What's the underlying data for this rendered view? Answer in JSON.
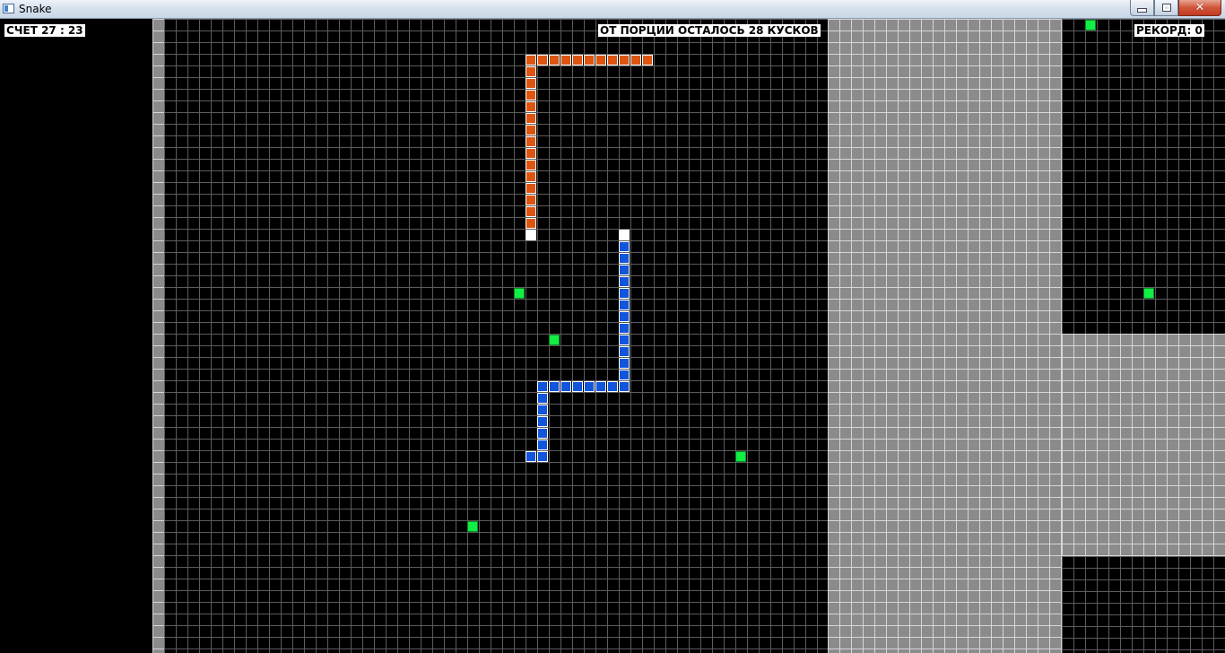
{
  "window": {
    "title": "Snake",
    "controls": {
      "minimize_icon": "minimize-icon",
      "maximize_icon": "restore-icon",
      "close_icon": "close-icon"
    }
  },
  "hud": {
    "score_text": "СЧЕТ 27 : 23",
    "portion_text": "ОТ ПОРЦИИ ОСТАЛОСЬ 28 КУСКОВ",
    "record_text": "РЕКОРД: 0"
  },
  "colors": {
    "background": "#000000",
    "grid_line_dark": "#5c5c5c",
    "wall_fill": "#8b8b8b",
    "wall_grid_line": "#d6d6d6",
    "snake_orange": "#dd5511",
    "snake_blue": "#1155dd",
    "snake_head": "#ffffff",
    "food": "#11ee44",
    "label_bg": "#ffffff",
    "label_text": "#000000"
  },
  "board": {
    "cell_size": 13,
    "origin_col": 0,
    "snakes": [
      {
        "name": "orange",
        "color_key": "snake_orange",
        "head": [
          45,
          18
        ],
        "body": [
          [
            55,
            3
          ],
          [
            54,
            3
          ],
          [
            53,
            3
          ],
          [
            52,
            3
          ],
          [
            51,
            3
          ],
          [
            50,
            3
          ],
          [
            49,
            3
          ],
          [
            48,
            3
          ],
          [
            47,
            3
          ],
          [
            46,
            3
          ],
          [
            45,
            3
          ],
          [
            45,
            4
          ],
          [
            45,
            5
          ],
          [
            45,
            6
          ],
          [
            45,
            7
          ],
          [
            45,
            8
          ],
          [
            45,
            9
          ],
          [
            45,
            10
          ],
          [
            45,
            11
          ],
          [
            45,
            12
          ],
          [
            45,
            13
          ],
          [
            45,
            14
          ],
          [
            45,
            15
          ],
          [
            45,
            16
          ],
          [
            45,
            17
          ]
        ]
      },
      {
        "name": "blue",
        "color_key": "snake_blue",
        "head": [
          53,
          18
        ],
        "body": [
          [
            53,
            19
          ],
          [
            53,
            20
          ],
          [
            53,
            21
          ],
          [
            53,
            22
          ],
          [
            53,
            23
          ],
          [
            53,
            24
          ],
          [
            53,
            25
          ],
          [
            53,
            26
          ],
          [
            53,
            27
          ],
          [
            53,
            28
          ],
          [
            53,
            29
          ],
          [
            53,
            30
          ],
          [
            53,
            31
          ],
          [
            52,
            31
          ],
          [
            51,
            31
          ],
          [
            50,
            31
          ],
          [
            49,
            31
          ],
          [
            48,
            31
          ],
          [
            47,
            31
          ],
          [
            46,
            31
          ],
          [
            46,
            32
          ],
          [
            46,
            33
          ],
          [
            46,
            34
          ],
          [
            46,
            35
          ],
          [
            46,
            36
          ],
          [
            46,
            37
          ],
          [
            45,
            37
          ]
        ]
      }
    ],
    "food": [
      [
        93,
        0
      ],
      [
        44,
        23
      ],
      [
        47,
        27
      ],
      [
        98,
        23
      ],
      [
        63,
        37
      ],
      [
        40,
        43
      ]
    ]
  }
}
